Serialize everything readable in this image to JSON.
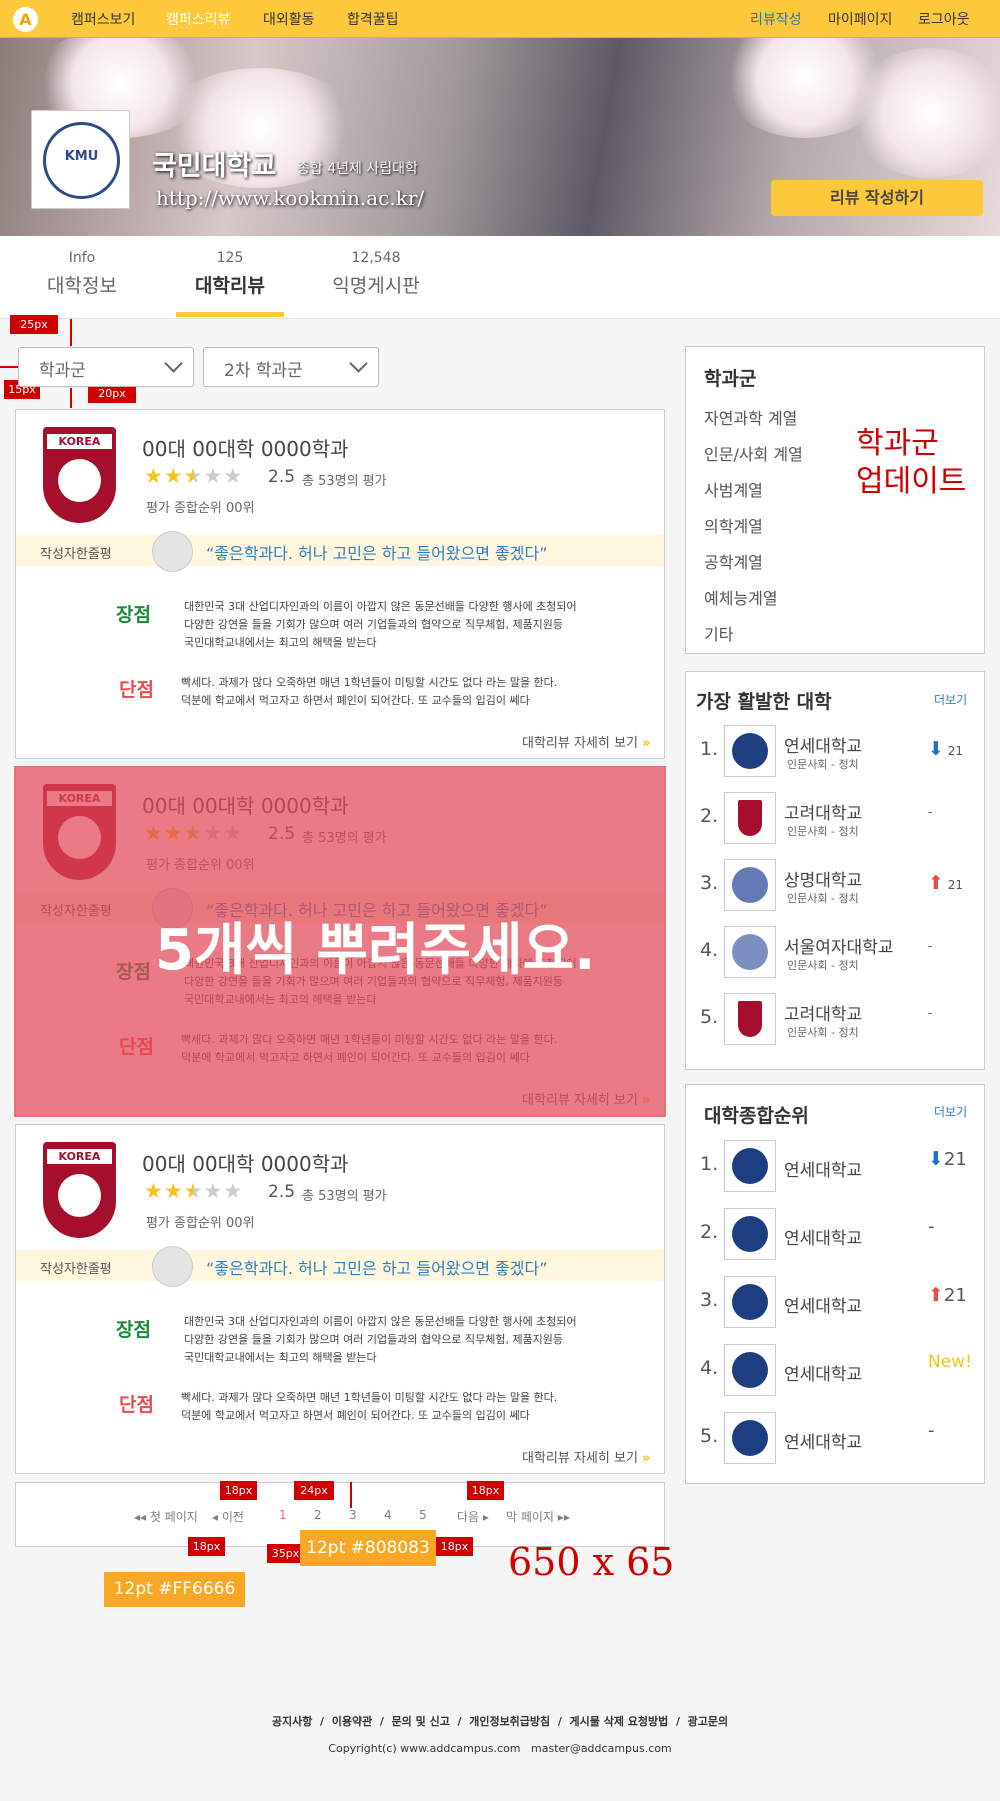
{
  "topnav": {
    "logo": "A",
    "items": [
      "캠퍼스보기",
      "캠퍼스리뷰",
      "대외활동",
      "합격꿀팁"
    ],
    "right": [
      "리뷰작성",
      "마이페이지",
      "로그아웃"
    ]
  },
  "hero": {
    "emblem_text": "KMU",
    "name": "국민대학교",
    "type": "종합 4년제 사립대학",
    "url": "http://www.kookmin.ac.kr/",
    "write_button": "리뷰 작성하기"
  },
  "tabs": [
    {
      "small": "Info",
      "label": "대학정보"
    },
    {
      "small": "125",
      "label": "대학리뷰"
    },
    {
      "small": "12,548",
      "label": "익명게시판"
    }
  ],
  "filters": [
    "학과군",
    "2차 학과군"
  ],
  "spec_tags": {
    "t25": "25px",
    "t15": "15px",
    "t20": "20px"
  },
  "card": {
    "shield_text": "KOREA",
    "title": "00대 00대학 0000학과",
    "stars": 2.5,
    "rating": "2.5",
    "rating_count": "총 53명의 평가",
    "rank": "평가 종합순위 00위",
    "best_label": "작성자한줄평",
    "quote": "“좋은학과다. 허나 고민은 하고 들어왔으면 좋겠다”",
    "pros_label": "장점",
    "pros": [
      "대한민국 3대 산업디자인과의 이름이 아깝지 않은 동문선배들 다양한 행사에 초청되어",
      "다양한 강연을 들을 기회가 많으며 여러 기업들과의 협약으로 직무체험, 제품지원등",
      "국민대학교내에서는 최고의 해택을 받는다"
    ],
    "cons_label": "단점",
    "cons": [
      "빡세다. 과제가 많다 오죽하면 매년 1학년들이 미팅할 시간도 없다 라는 말을 한다.",
      "덕분에 학교에서 먹고자고 하면서 폐인이 되어간다. 또 교수들의 입김이 쎄다"
    ],
    "more": "대학리뷰 자세히 보기"
  },
  "overlay_text": "5개씩 뿌려주세요.",
  "pager": {
    "first": "◂◂ 첫 페이지",
    "prev": "◂ 이전",
    "pages": [
      "1",
      "2",
      "3",
      "4",
      "5"
    ],
    "current": "1",
    "next": "다음 ▸",
    "last": "막 페이지 ▸▸",
    "tags": [
      "18px",
      "24px",
      "18px",
      "18px",
      "35px",
      "18px"
    ],
    "spec_normal": "12pt  #808083",
    "spec_active": "12pt  #FF6666",
    "size_note": "650 x 65"
  },
  "sidebar": {
    "categories": {
      "title": "학과군",
      "items": [
        "자연과학 계열",
        "인문/사회 계열",
        "사범계열",
        "의학계열",
        "공학계열",
        "예체능계열",
        "기타"
      ],
      "note": "학과군\n업데이트"
    },
    "active": {
      "title": "가장 활발한 대학",
      "more": "더보기",
      "items": [
        {
          "rank": "1.",
          "name": "연세대학교",
          "sub": "인문사회 - 정치",
          "trend": "down",
          "change": "21",
          "emblem": "yonsei"
        },
        {
          "rank": "2.",
          "name": "고려대학교",
          "sub": "인문사회 - 정치",
          "trend": "same",
          "change": "-",
          "emblem": "korea"
        },
        {
          "rank": "3.",
          "name": "상명대학교",
          "sub": "인문사회 - 정치",
          "trend": "up",
          "change": "21",
          "emblem": "smu"
        },
        {
          "rank": "4.",
          "name": "서울여자대학교",
          "sub": "인문사회 - 정치",
          "trend": "same",
          "change": "-",
          "emblem": "swu"
        },
        {
          "rank": "5.",
          "name": "고려대학교",
          "sub": "인문사회 - 정치",
          "trend": "same",
          "change": "-",
          "emblem": "korea"
        }
      ]
    },
    "overall": {
      "title": "대학종합순위",
      "more": "더보기",
      "items": [
        {
          "rank": "1.",
          "name": "연세대학교",
          "trend": "down",
          "change": "21"
        },
        {
          "rank": "2.",
          "name": "연세대학교",
          "trend": "same",
          "change": "-"
        },
        {
          "rank": "3.",
          "name": "연세대학교",
          "trend": "up",
          "change": "21"
        },
        {
          "rank": "4.",
          "name": "연세대학교",
          "trend": "new",
          "change": "New!"
        },
        {
          "rank": "5.",
          "name": "연세대학교",
          "trend": "same",
          "change": "-"
        }
      ]
    }
  },
  "footer": {
    "links": [
      "공지사항",
      "이용약관",
      "문의 및 신고",
      "개인정보취급방침",
      "게시물 삭제 요청방법",
      "광고문의"
    ],
    "separator": "/",
    "copyright": "Copyright(c) www.addcampus.com",
    "email": "master@addcampus.com"
  },
  "colors": {
    "brand": "#fdc93a",
    "link_blue": "#2f7fc1",
    "pros_green": "#1a8a3a",
    "cons_red": "#e84d4d",
    "pager_active": "#FF6666",
    "pager_normal": "#808083"
  }
}
